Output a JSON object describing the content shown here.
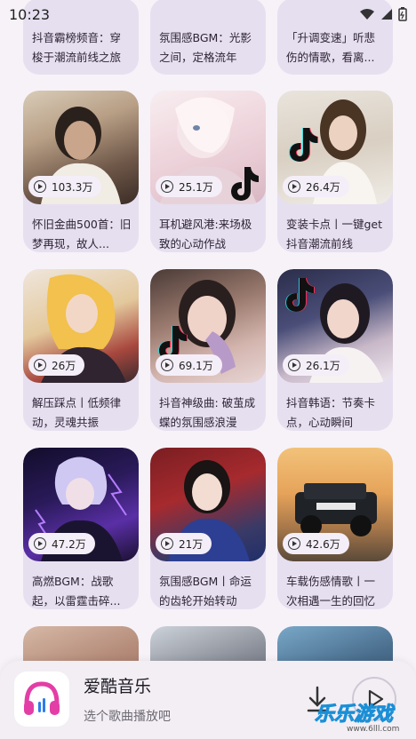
{
  "status": {
    "time": "10:23"
  },
  "cards": [
    {
      "title": "抖音霸榜频音：穿梭于潮流前线之旅",
      "plays": ""
    },
    {
      "title": "氛围感BGM：光影之间，定格流年",
      "plays": ""
    },
    {
      "title": "「升调变速」听悲伤的情歌，看离...",
      "plays": ""
    },
    {
      "title": "怀旧金曲500首：旧梦再现，故人...",
      "plays": "103.3万"
    },
    {
      "title": "耳机避风港:来场极致的心动作战",
      "plays": "25.1万"
    },
    {
      "title": "变装卡点丨一键get抖音潮流前线",
      "plays": "26.4万"
    },
    {
      "title": "解压踩点丨低频律动，灵魂共振",
      "plays": "26万"
    },
    {
      "title": "抖音神级曲: 破茧成蝶的氛围感浪漫",
      "plays": "69.1万"
    },
    {
      "title": "抖音韩语：节奏卡点，心动瞬间",
      "plays": "26.1万"
    },
    {
      "title": "高燃BGM：战歌起，以雷霆击碎...",
      "plays": "47.2万"
    },
    {
      "title": "氛围感BGM丨命运的齿轮开始转动",
      "plays": "21万"
    },
    {
      "title": "车载伤感情歌丨一次相遇一生的回忆",
      "plays": "42.6万"
    }
  ],
  "player": {
    "app_name": "爱酷音乐",
    "subtitle": "选个歌曲播放吧"
  },
  "watermark": {
    "text": "乐乐游戏",
    "url": "www.6lll.com"
  },
  "colors": {
    "accent": "#e33ea6",
    "card_bg": "#e6dff0",
    "page_bg": "#f6f2f8"
  }
}
